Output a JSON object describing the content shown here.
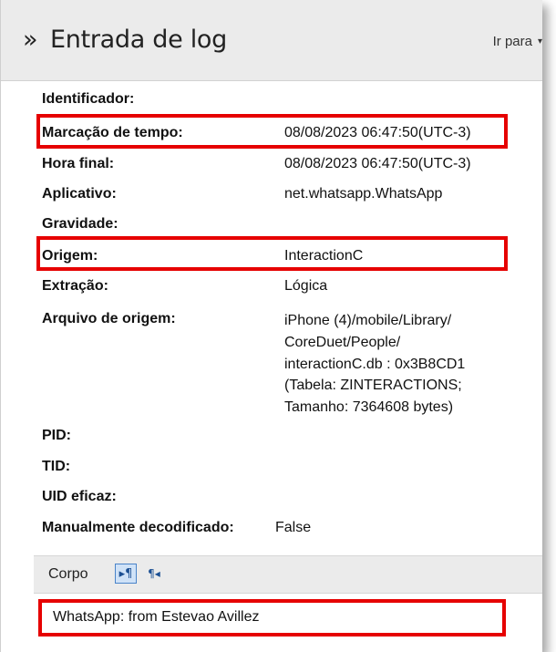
{
  "header": {
    "icon": "double-chevron-right-icon",
    "title": "Entrada de log",
    "goto_label": "Ir para",
    "goto_caret": "▾"
  },
  "fields": {
    "identificador": {
      "label": "Identificador:",
      "value": ""
    },
    "marcacao": {
      "label": "Marcação de tempo:",
      "value": "08/08/2023 06:47:50(UTC-3)"
    },
    "hora_final": {
      "label": "Hora final:",
      "value": "08/08/2023 06:47:50(UTC-3)"
    },
    "aplicativo": {
      "label": "Aplicativo:",
      "value": "net.whatsapp.WhatsApp"
    },
    "gravidade": {
      "label": "Gravidade:",
      "value": ""
    },
    "origem": {
      "label": "Origem:",
      "value": "InteractionC"
    },
    "extracao": {
      "label": "Extração:",
      "value": "Lógica"
    },
    "arquivo": {
      "label": "Arquivo de origem:",
      "lines": [
        "iPhone (4)/mobile/Library/",
        "CoreDuet/People/",
        "interactionC.db : 0x3B8CD1",
        "(Tabela: ZINTERACTIONS;",
        "Tamanho: 7364608 bytes)"
      ]
    },
    "pid": {
      "label": "PID:",
      "value": ""
    },
    "tid": {
      "label": "TID:",
      "value": ""
    },
    "uid": {
      "label": "UID eficaz:",
      "value": ""
    },
    "manual": {
      "label": "Manualmente decodificado:",
      "value": "False"
    }
  },
  "body_section": {
    "label": "Corpo",
    "btn_ltr_icon": "ltr-paragraph-icon",
    "btn_rtl_icon": "rtl-paragraph-icon",
    "text": "WhatsApp: from Estevao Avillez"
  },
  "colors": {
    "highlight": "#e60000",
    "header_bg": "#ebebeb",
    "toggle_active": "#cfe2f7"
  }
}
